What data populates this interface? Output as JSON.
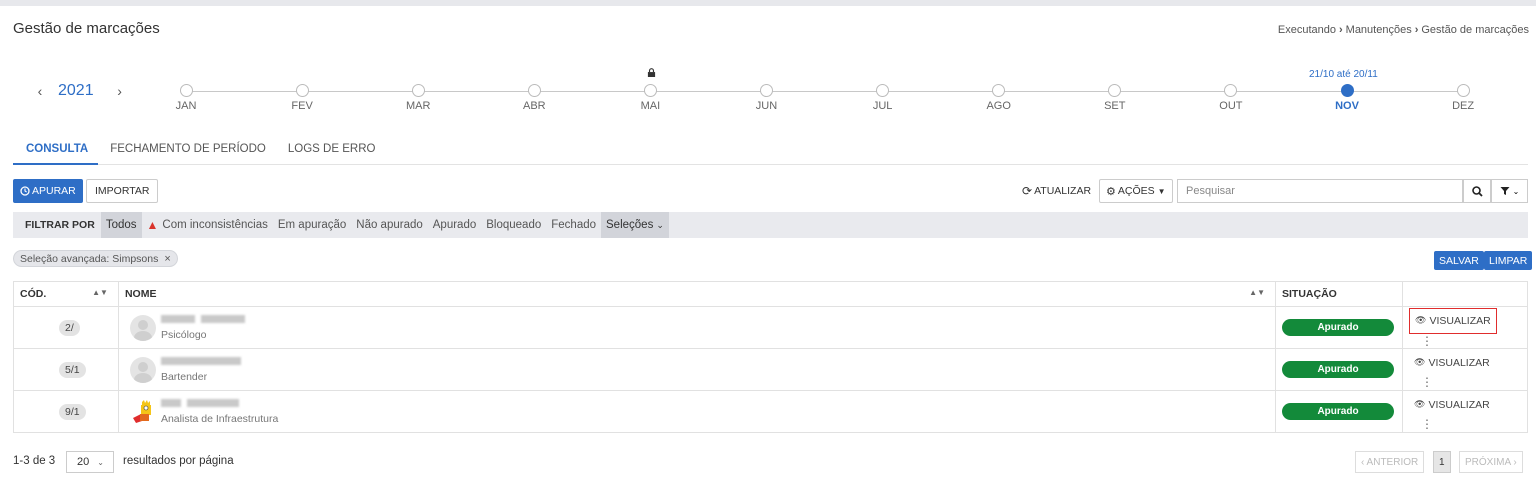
{
  "page": {
    "title": "Gestão de marcações"
  },
  "breadcrumb": [
    "Executando",
    "Manutenções",
    "Gestão de marcações"
  ],
  "timeline": {
    "year": "2021",
    "months": [
      "JAN",
      "FEV",
      "MAR",
      "ABR",
      "MAI",
      "JUN",
      "JUL",
      "AGO",
      "SET",
      "OUT",
      "NOV",
      "DEZ"
    ],
    "active_month": "NOV",
    "locked_month": "MAI",
    "active_range": "21/10 até 20/11"
  },
  "tabs": [
    "CONSULTA",
    "FECHAMENTO DE PERÍODO",
    "LOGS DE ERRO"
  ],
  "toolbar": {
    "apurar": "APURAR",
    "importar": "IMPORTAR",
    "atualizar": "ATUALIZAR",
    "acoes": "AÇÕES",
    "search_placeholder": "Pesquisar"
  },
  "filter": {
    "label": "FILTRAR POR",
    "options": [
      "Todos",
      "Com inconsistências",
      "Em apuração",
      "Não apurado",
      "Apurado",
      "Bloqueado",
      "Fechado",
      "Seleções"
    ],
    "selected": "Todos"
  },
  "chip": "Seleção avançada: Simpsons",
  "actions": {
    "salvar": "SALVAR",
    "limpar": "LIMPAR"
  },
  "table": {
    "headers": {
      "code": "CÓD.",
      "name": "NOME",
      "status": "SITUAÇÃO"
    },
    "rows": [
      {
        "code": "2/",
        "role": "Psicólogo",
        "status": "Apurado",
        "action": "VISUALIZAR"
      },
      {
        "code": "5/1",
        "role": "Bartender",
        "status": "Apurado",
        "action": "VISUALIZAR"
      },
      {
        "code": "9/1",
        "role": "Analista de Infraestrutura",
        "status": "Apurado",
        "action": "VISUALIZAR"
      }
    ]
  },
  "pagination": {
    "info": "1-3 de 3",
    "per_page": "20",
    "per_page_label": "resultados por página",
    "prev": "‹ ANTERIOR",
    "current": "1",
    "next": "PRÓXIMA ›"
  },
  "colors": {
    "primary": "#2e6ec6",
    "status_green": "#138a3a",
    "highlight": "#e02d2d"
  }
}
